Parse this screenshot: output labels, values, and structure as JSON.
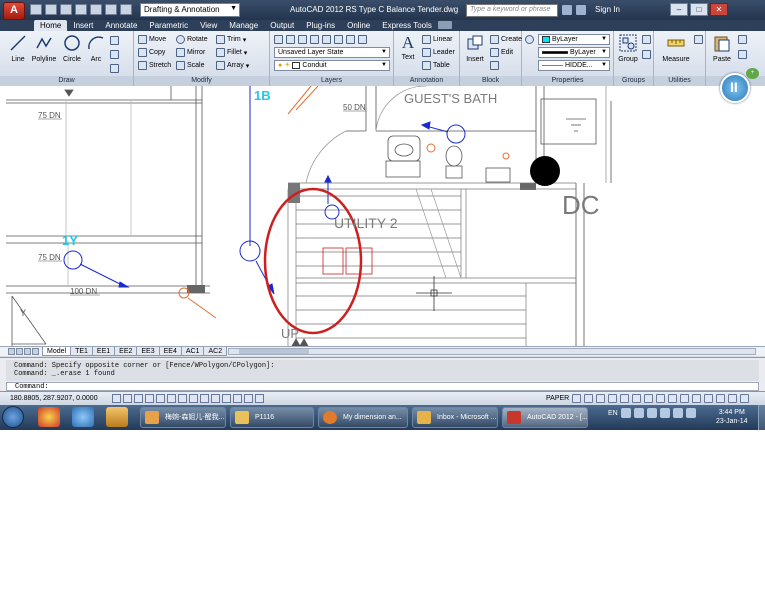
{
  "title_bar": {
    "app_title": "AutoCAD 2012    RS Type C Balance Tender.dwg",
    "workspace": "Drafting & Annotation",
    "search_placeholder": "Type a keyword or phrase",
    "sign_in": "Sign In",
    "minimize": "–",
    "maximize": "□",
    "close": "✕"
  },
  "ribbon_tabs": [
    "Home",
    "Insert",
    "Annotate",
    "Parametric",
    "View",
    "Manage",
    "Output",
    "Plug-ins",
    "Online",
    "Express Tools"
  ],
  "ribbon": {
    "draw": {
      "label": "Draw",
      "line": "Line",
      "polyline": "Polyline",
      "circle": "Circle",
      "arc": "Arc"
    },
    "modify": {
      "label": "Modify",
      "move": "Move",
      "rotate": "Rotate",
      "trim": "Trim",
      "copy": "Copy",
      "mirror": "Mirror",
      "fillet": "Fillet",
      "stretch": "Stretch",
      "scale": "Scale",
      "array": "Array"
    },
    "layers": {
      "label": "Layers",
      "layer_state": "Unsaved Layer State",
      "current_layer": "Conduit"
    },
    "annotation": {
      "label": "Annotation",
      "text": "Text",
      "linear": "Linear",
      "leader": "Leader",
      "table": "Table"
    },
    "block": {
      "label": "Block",
      "insert": "Insert",
      "create": "Create",
      "edit": "Edit"
    },
    "properties": {
      "label": "Properties",
      "color": "ByLayer",
      "lineweight": "ByLayer",
      "linetype": "HIDDE..."
    },
    "groups": {
      "label": "Groups",
      "group": "Group"
    },
    "utilities": {
      "label": "Utilities",
      "measure": "Measure"
    },
    "clipboard": {
      "label": "Clip",
      "paste": "Paste"
    }
  },
  "drawing": {
    "labels": {
      "room_guest_bath": "GUEST'S BATH",
      "room_utility": "UTILITY 2",
      "dc": "DC",
      "up": "UP",
      "tag_1b": "1B",
      "tag_1y": "1Y",
      "dn_50": "50 DN",
      "dn_75a": "75 DN",
      "dn_75b": "75 DN",
      "dn_100": "100 DN"
    }
  },
  "layout_tabs": [
    "Model",
    "TE1",
    "EE1",
    "EE2",
    "EE3",
    "EE4",
    "AC1",
    "AC2"
  ],
  "active_layout_tab": "Model",
  "command_line": {
    "history_1": "Command: Specify opposite corner or [Fence/WPolygon/CPolygon]:",
    "history_2": "Command: _.erase 1 found",
    "prompt": "Command:"
  },
  "status_bar": {
    "coordinates": "180.8805, 287.9207, 0.0000",
    "space": "PAPER"
  },
  "taskbar": {
    "tasks": [
      {
        "label": "梅婉-森姐儿-醒我..."
      },
      {
        "label": "P1116"
      },
      {
        "label": "My dimension an..."
      },
      {
        "label": "Inbox - Microsoft ..."
      },
      {
        "label": "AutoCAD 2012 - [..."
      }
    ],
    "language": "EN",
    "time": "3:44 PM",
    "date": "23-Jan-14"
  },
  "colors": {
    "title_bar": "#2b3d57",
    "highlight_circle": "#cc2020",
    "cyan_tag": "#22c8e8",
    "blue_leader": "#1a2ad0",
    "orange_fixture": "#e07030"
  }
}
